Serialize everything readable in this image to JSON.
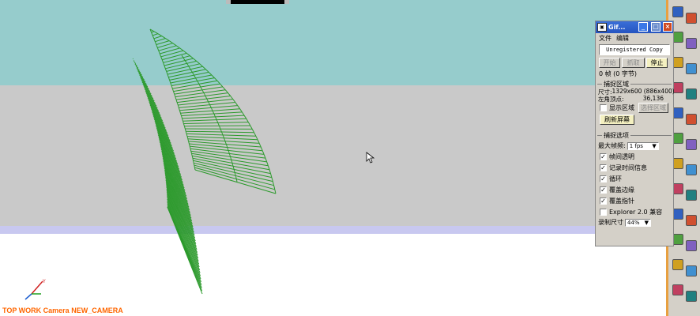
{
  "viewport": {
    "camera_label": "TOP WORK Camera NEW_CAMERA",
    "axis_labels": {
      "x": "X",
      "y": "Y",
      "z": "Z"
    },
    "colors": {
      "sky": "#96cccc",
      "ground": "#c9c9c9",
      "mesh": "#2c9a2c",
      "label": "#ff6600"
    }
  },
  "gif_window": {
    "title": "Gif...",
    "title_buttons": {
      "minimize": "_",
      "maximize": "□",
      "close": "×"
    },
    "menu": [
      "文件",
      "编辑"
    ],
    "unregistered": "Unregistered Copy",
    "buttons": {
      "start": "开始",
      "grab": "抓取",
      "stop": "停止"
    },
    "frame_count": "0 帧 (0 字节)",
    "capture_region": {
      "title": "捕捉区域",
      "size_label": "尺寸:",
      "size_value": "1329x600 (886x400)",
      "corner_label": "左角顶点:",
      "corner_value": "36,136",
      "show_region": "显示区域",
      "show_region_checked": false,
      "select_region": "选择区域",
      "refresh": "刷新屏幕"
    },
    "capture_options": {
      "title": "捕捉选项",
      "max_fps_label": "最大帧频:",
      "max_fps_value": "1 fps",
      "options": [
        {
          "label": "帧间透明",
          "checked": true
        },
        {
          "label": "记录时间信息",
          "checked": true
        },
        {
          "label": "循环",
          "checked": true
        },
        {
          "label": "覆盖边缘",
          "checked": true
        },
        {
          "label": "覆盖指针",
          "checked": true
        },
        {
          "label": "Explorer 2.0 兼容",
          "checked": false
        }
      ],
      "record_size_label": "录制尺寸",
      "record_size_value": "44%"
    }
  },
  "toolbar": {
    "icons": [
      "view-icon",
      "layer-icon",
      "cube-icon",
      "shade-icon",
      "box-icon",
      "sphere-icon",
      "render-icon",
      "material-icon",
      "book-icon",
      "light-icon",
      "camera-icon",
      "zoom-icon",
      "pan-icon",
      "rotate-icon",
      "measure-icon",
      "snap-icon",
      "select-icon",
      "paint-icon",
      "grid-icon",
      "axis-icon",
      "fit-icon",
      "settings-icon",
      "help-icon",
      "export-icon"
    ]
  }
}
